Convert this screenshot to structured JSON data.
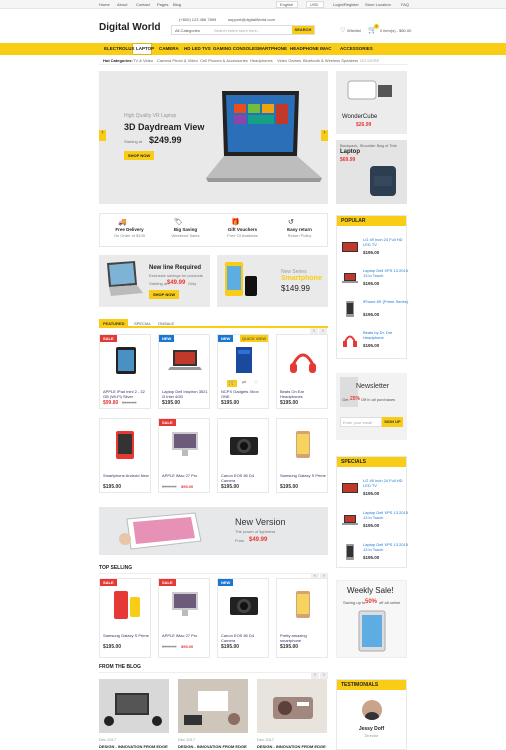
{
  "topbar": {
    "home": "Home",
    "about": "About",
    "contact": "Contact",
    "pages": "Pages",
    "blog": "Blog",
    "language": "English",
    "currency": "USD",
    "login": "Login/Register",
    "store": "Store Location",
    "faq": "FAQ"
  },
  "header": {
    "logo": "Digital World",
    "phone": "(+800) 123 456 7899",
    "email": "support@digitalWorld.com",
    "search_category": "All Categories",
    "search_placeholder": "Search entire store here...",
    "search_button": "SEARCH",
    "wishlist": "Wishlist",
    "cart_label": "0 item(s) - $50.00",
    "cart_count": "0"
  },
  "nav": [
    "ELECTROLUX",
    "LAPTOP",
    "CAMERA",
    "HD LED TVS",
    "GAMING CONSOLE",
    "SMARTPHONE",
    "HEADPHONE",
    "IMAC",
    "ACCESSORIES"
  ],
  "categories": {
    "label": "Hot Categories:",
    "items": [
      "TV & Video",
      "Camera Photo & Video",
      "Cell Phones & Accessories",
      "Headphones",
      "Video Games",
      "Bluetooth & Wireless Speakers",
      "GO MORE"
    ]
  },
  "hero": {
    "subtitle": "High Quality VR Laptop",
    "title": "3D Daydream View",
    "price_prefix": "Starting at",
    "price": "$249.99",
    "button": "SHOP NOW"
  },
  "side_banners": {
    "top": {
      "title": "WonderCube",
      "price": "$26.99"
    },
    "bottom": {
      "small": "Backpack, Shoulder Bag of Tote",
      "title": "Laptop",
      "price": "$69.99"
    }
  },
  "features": [
    {
      "icon": "truck-icon",
      "a": "Free Delivery",
      "b": "On Order of $100"
    },
    {
      "icon": "tag-icon",
      "a": "Big Saving",
      "b": "Weekend Sales"
    },
    {
      "icon": "gift-icon",
      "a": "Gift Vouchers",
      "b": "Free Of Available"
    },
    {
      "icon": "return-icon",
      "a": "Easy return",
      "b": "Return Policy"
    }
  ],
  "promo1": {
    "title": "New line Required",
    "sub": "Exclusive savings for products",
    "price_prefix": "Starting at",
    "price": "$49.99",
    "suffix": "Only",
    "button": "SHOP NOW"
  },
  "promo2": {
    "label": "New Series",
    "title": "Smartphone",
    "price": "$149.99"
  },
  "tabs": [
    "FEATURED",
    "SPECIAL",
    "ONSALE"
  ],
  "products_row1": [
    {
      "badge": "SALE",
      "name": "APPLE iPad mini 2 - 32 GB (Wi-Fi) Silver",
      "price": "$99.80",
      "old": "$190.00"
    },
    {
      "badge": "NEW",
      "name": "Laptop Dell Inspiron 3521 i3 Intel 4GB",
      "price": "$195.00",
      "old": ""
    },
    {
      "badge": "NEW",
      "name": "NCPX Gadgets Xbox ONE",
      "price": "$195.00",
      "old": "",
      "quick": "QUICK VIEW"
    },
    {
      "badge": "",
      "name": "Beats On Ear Headphones",
      "price": "$195.00",
      "old": ""
    }
  ],
  "products_row2": [
    {
      "badge": "",
      "name": "Smartphone Android New",
      "price": "$195.00",
      "old": ""
    },
    {
      "badge": "SALE",
      "name": "APPLE iMac 27 Pro",
      "price": "$95.00",
      "old": "$190.00"
    },
    {
      "badge": "",
      "name": "Canon EOS 80 D4 Camera",
      "price": "$195.00",
      "old": ""
    },
    {
      "badge": "",
      "name": "Samsung Galaxy S Prime",
      "price": "$195.00",
      "old": ""
    }
  ],
  "popular": {
    "title": "POPULAR",
    "items": [
      {
        "name": "LG 49 Inch 24 Full HD LED TV",
        "price": "$195.00"
      },
      {
        "name": "Laptop Dell XPS 13 2015 13 in Touch",
        "price": "$195.00"
      },
      {
        "name": "iPhone 6S (Prime Series)",
        "price": "$195.00"
      },
      {
        "name": "Beats by Dr. Dre Headphone",
        "price": "$195.00"
      }
    ]
  },
  "newsletter": {
    "title": "Newsletter",
    "sub_a": "Get",
    "pct": "25%",
    "sub_b": "Off in all purchases",
    "placeholder": "Enter your email",
    "button": "SIGN UP"
  },
  "specials": {
    "title": "SPECIALS",
    "items": [
      {
        "name": "LG 49 Inch 24 Full HD LED TV",
        "price": "$195.00"
      },
      {
        "name": "Laptop Dell XPS 13 2015 13 in Touch",
        "price": "$195.00"
      },
      {
        "name": "Laptop Dell XPS 13 2015 13 in Touch",
        "price": "$195.00"
      }
    ]
  },
  "version": {
    "title": "New Version",
    "sub": "The power of lightness",
    "price_prefix": "From",
    "price": "$49.99"
  },
  "top_selling": {
    "title": "TOP SELLING",
    "items": [
      {
        "badge": "SALE",
        "name": "Samsung Galaxy S Prime",
        "price": "$195.00"
      },
      {
        "badge": "SALE",
        "name": "APPLE iMac 27 Pro",
        "price": "$95.00",
        "old": "$190.00"
      },
      {
        "badge": "NEW",
        "name": "Canon EOS 80 D4 Camera",
        "price": "$195.00"
      },
      {
        "badge": "",
        "name": "Pretty amazing smartphone",
        "price": "$195.00"
      }
    ]
  },
  "weekly": {
    "title": "Weekly Sale!",
    "pre": "Saving up to",
    "pct": "50%",
    "post": "off all online"
  },
  "blog": {
    "title": "FROM THE BLOG",
    "posts": [
      {
        "date": "Dec 2017",
        "title": "DESIGN - INNOVATION FROM EDGE"
      },
      {
        "date": "Dec 2017",
        "title": "DESIGN - INNOVATION FROM EDGE"
      },
      {
        "date": "Dec 2017",
        "title": "DESIGN - INNOVATION FROM EDGE"
      }
    ]
  },
  "testimonial": {
    "title": "TESTIMONIALS",
    "name": "Jessy Doff",
    "role": "Director"
  }
}
